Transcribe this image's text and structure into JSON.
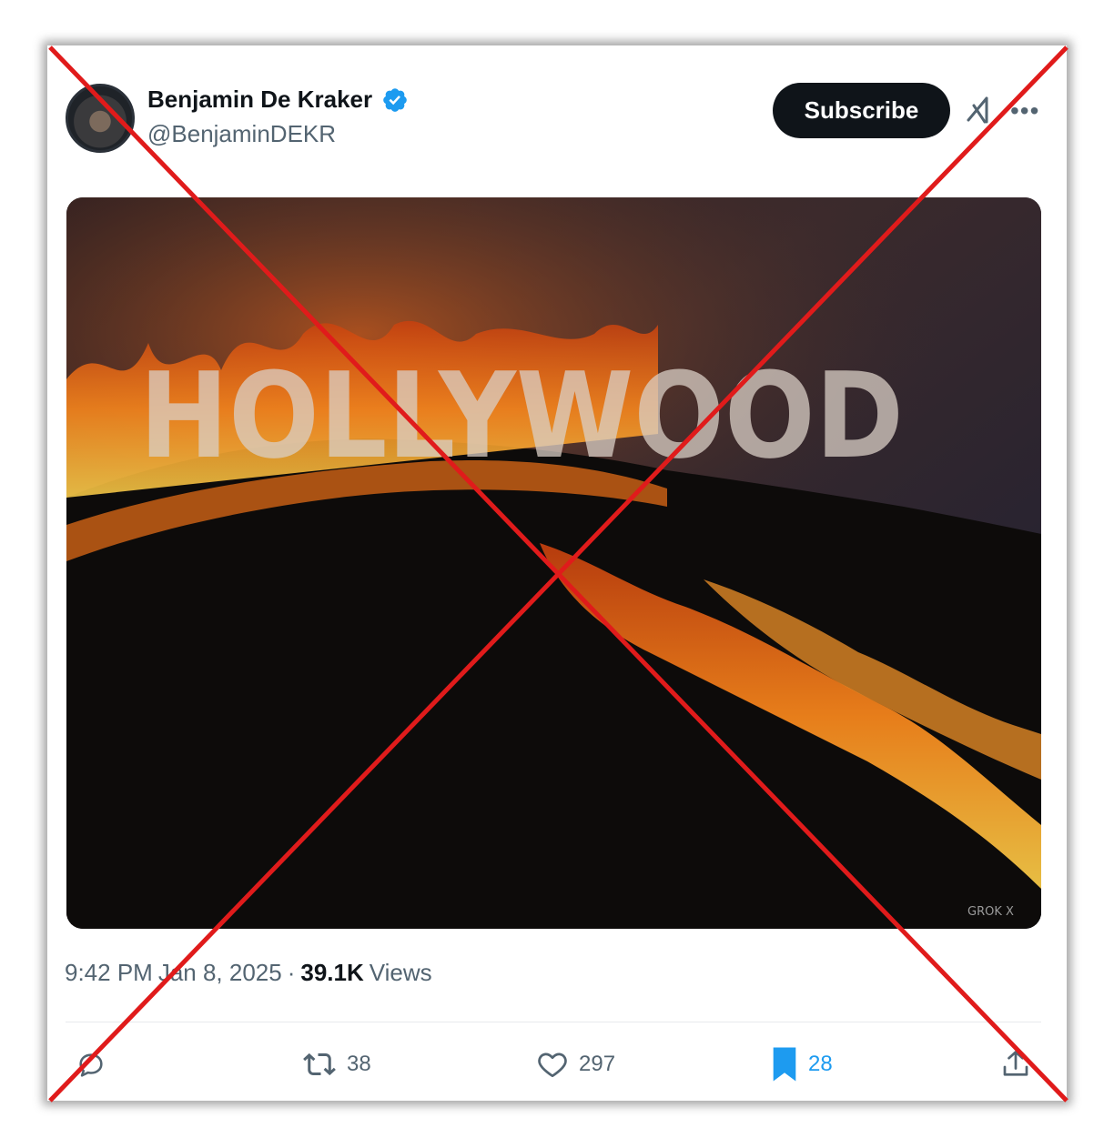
{
  "tweet": {
    "author": {
      "display_name": "Benjamin De Kraker",
      "handle": "@BenjaminDEKR",
      "verified_icon": "verified-badge-icon"
    },
    "subscribe_label": "Subscribe",
    "media": {
      "sign_text": "HOLLYWOOD",
      "watermark": "GROK X"
    },
    "time": "9:42 PM",
    "date": "Jan 8, 2025",
    "separator": "·",
    "views_count": "39.1K",
    "views_label": "Views",
    "actions": {
      "reply": {
        "icon": "reply-icon",
        "count": ""
      },
      "repost": {
        "icon": "repost-icon",
        "count": "38"
      },
      "like": {
        "icon": "heart-icon",
        "count": "297"
      },
      "bookmark": {
        "icon": "bookmark-icon",
        "count": "28"
      },
      "share": {
        "icon": "share-icon",
        "count": ""
      }
    }
  },
  "colors": {
    "accent": "#1d9bf0",
    "cross": "#e01b1b",
    "text_primary": "#0f1419",
    "text_secondary": "#536471"
  }
}
